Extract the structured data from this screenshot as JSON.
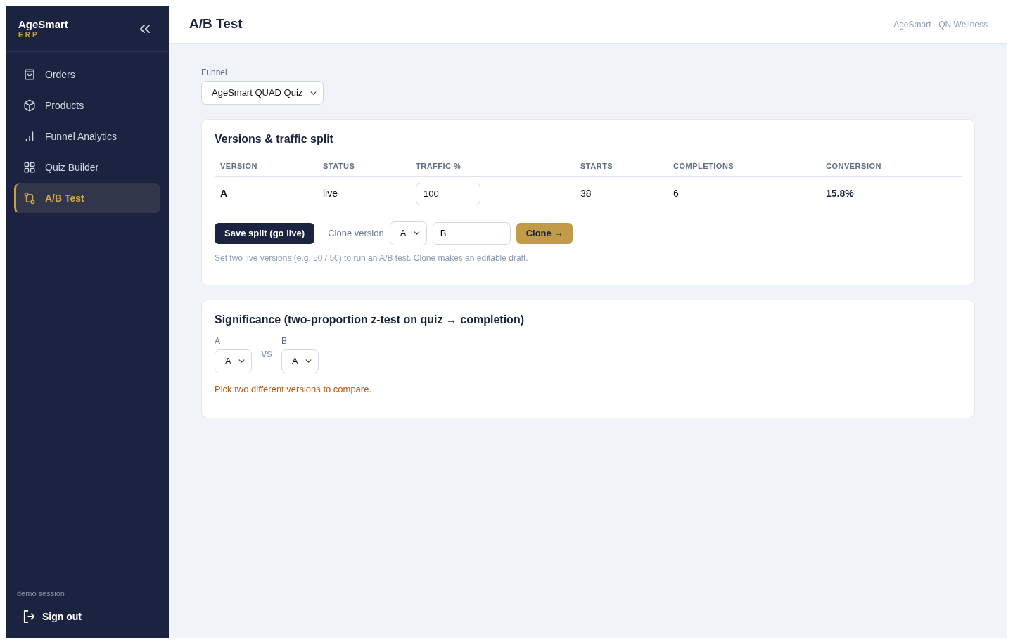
{
  "sidebar": {
    "brand": "AgeSmart",
    "brand_sub": "ERP",
    "items": [
      {
        "label": "Orders",
        "selected": false
      },
      {
        "label": "Products",
        "selected": false
      },
      {
        "label": "Funnel Analytics",
        "selected": false
      },
      {
        "label": "Quiz Builder",
        "selected": false
      },
      {
        "label": "A/B Test",
        "selected": true
      }
    ],
    "session": "demo session",
    "sign_out": "Sign out"
  },
  "header": {
    "title": "A/B Test",
    "org": "AgeSmart · QN Wellness"
  },
  "funnel": {
    "label": "Funnel",
    "value": "AgeSmart QUAD Quiz"
  },
  "versions": {
    "title": "Versions & traffic split",
    "table": {
      "columns": [
        "VERSION",
        "STATUS",
        "TRAFFIC %",
        "STARTS",
        "COMPLETIONS",
        "CONVERSION"
      ],
      "rows": [
        {
          "version": "A",
          "status": "live",
          "traffic": "100",
          "starts": "38",
          "completions": "6",
          "conversion": "15.8%"
        }
      ]
    },
    "save_button": "Save split (go live)",
    "clone_label": "Clone version",
    "clone_source": "A",
    "clone_name": "B",
    "clone_button": "Clone →",
    "help": "Set two live versions (e.g. 50 / 50) to run an A/B test. Clone makes an editable draft."
  },
  "significance": {
    "title": "Significance (two-proportion z-test on quiz → completion)",
    "a_label": "A",
    "a_value": "A",
    "vs": "VS",
    "b_label": "B",
    "b_value": "A",
    "message": "Pick two different versions to compare."
  }
}
